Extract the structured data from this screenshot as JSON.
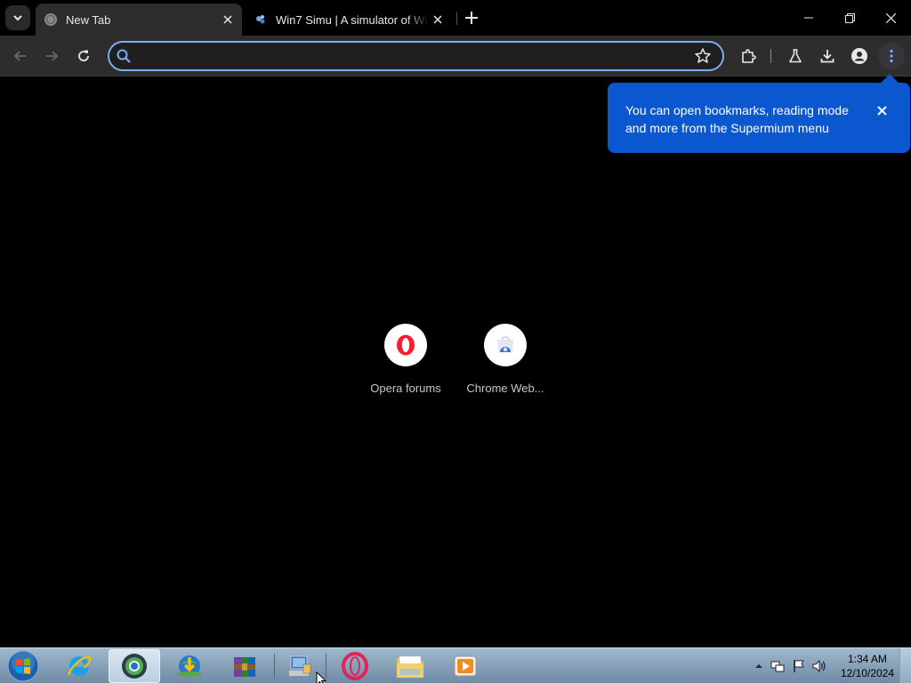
{
  "browser": {
    "tabs": [
      {
        "title": "New Tab",
        "active": true
      },
      {
        "title": "Win7 Simu | A simulator of Win",
        "active": false
      }
    ],
    "omnibox": {
      "value": "",
      "placeholder": ""
    },
    "bubble": {
      "line1": "You can open bookmarks, reading mode",
      "line2": "and more from the Supermium menu"
    },
    "shortcuts": [
      {
        "label": "Opera forums",
        "icon": "opera-icon"
      },
      {
        "label": "Chrome Web...",
        "icon": "chrome-web-store-icon"
      }
    ],
    "accent": "#0b57d0",
    "focus_ring": "#7cacf8"
  },
  "taskbar": {
    "apps": [
      {
        "name": "internet-explorer-icon"
      },
      {
        "name": "supermium-browser-icon",
        "active": true
      },
      {
        "name": "download-manager-icon"
      },
      {
        "name": "winrar-icon"
      },
      {
        "name": "remote-desktop-icon"
      },
      {
        "name": "opera-icon"
      },
      {
        "name": "file-explorer-icon"
      },
      {
        "name": "media-player-icon"
      }
    ],
    "clock": {
      "time": "1:34 AM",
      "date": "12/10/2024"
    }
  }
}
